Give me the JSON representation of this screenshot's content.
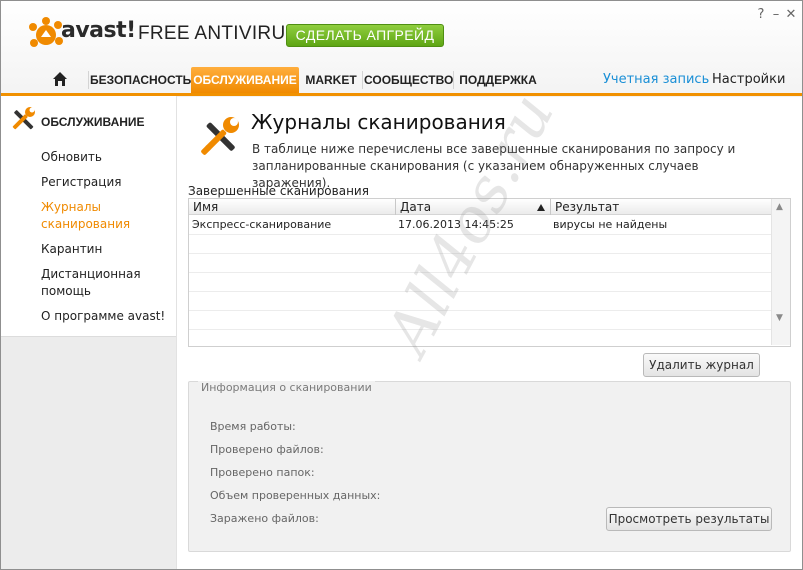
{
  "app": {
    "logo_text": "avast!",
    "product": "FREE ANTIVIRUS",
    "upgrade_label": "СДЕЛАТЬ АПГРЕЙД",
    "window_help": "?",
    "window_minimize": "–",
    "window_close": "✕"
  },
  "nav": {
    "items": [
      "БЕЗОПАСНОСТЬ",
      "ОБСЛУЖИВАНИЕ",
      "MARKET",
      "СООБЩЕСТВО",
      "ПОДДЕРЖКА"
    ],
    "account": "Учетная запись",
    "settings": "Настройки"
  },
  "sidebar": {
    "title": "ОБСЛУЖИВАНИЕ",
    "items": [
      "Обновить",
      "Регистрация",
      "Журналы сканирования",
      "Карантин",
      "Дистанционная помощь",
      "О программе avast!"
    ]
  },
  "main": {
    "title": "Журналы сканирования",
    "description": "В таблице ниже перечислены все завершенные сканирования по запросу и запланированные сканирования (с указанием обнаруженных случаев заражения).",
    "section_label": "Завершенные сканирования",
    "columns": [
      "Имя",
      "Дата",
      "Результат"
    ],
    "rows": [
      {
        "name": "Экспресс-сканирование",
        "date": "17.06.2013 14:45:25",
        "result": "вирусы не найдены"
      }
    ],
    "delete_button": "Удалить журнал"
  },
  "info": {
    "legend": "Информация о сканировании",
    "labels": [
      "Время работы:",
      "Проверено файлов:",
      "Проверено папок:",
      "Объем проверенных данных:",
      "Заражено файлов:"
    ],
    "view_results_button": "Просмотреть результаты"
  },
  "watermark": "All4os.ru",
  "colors": {
    "accent_orange": "#f08a00",
    "upgrade_green": "#6cb421",
    "link_blue": "#1a8fd6"
  }
}
